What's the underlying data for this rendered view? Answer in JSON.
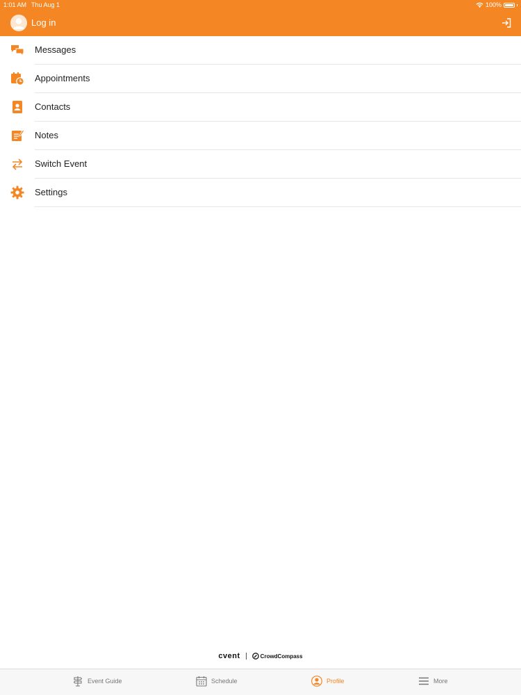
{
  "status_bar": {
    "time": "1:01 AM",
    "date": "Thu Aug 1",
    "battery": "100%",
    "battery_level": 1.0
  },
  "header": {
    "login_label": "Log in",
    "avatar_icon": "user-avatar-icon",
    "login_icon": "sign-in-icon"
  },
  "menu": {
    "items": [
      {
        "label": "Messages",
        "icon": "chat-bubbles-icon"
      },
      {
        "label": "Appointments",
        "icon": "calendar-clock-icon"
      },
      {
        "label": "Contacts",
        "icon": "contact-book-icon"
      },
      {
        "label": "Notes",
        "icon": "notepad-icon"
      },
      {
        "label": "Switch Event",
        "icon": "swap-arrows-icon"
      },
      {
        "label": "Settings",
        "icon": "gear-icon"
      }
    ]
  },
  "brand": {
    "left": "cvent",
    "right": "CrowdCompass"
  },
  "tabbar": {
    "tabs": [
      {
        "label": "Event Guide",
        "icon": "signpost-icon",
        "active": false
      },
      {
        "label": "Schedule",
        "icon": "calendar-icon",
        "active": false
      },
      {
        "label": "Profile",
        "icon": "user-circle-icon",
        "active": true
      },
      {
        "label": "More",
        "icon": "hamburger-menu-icon",
        "active": false
      }
    ]
  },
  "colors": {
    "accent": "#f58624",
    "divider": "#e6e6e6",
    "tab_inactive": "#777777"
  }
}
